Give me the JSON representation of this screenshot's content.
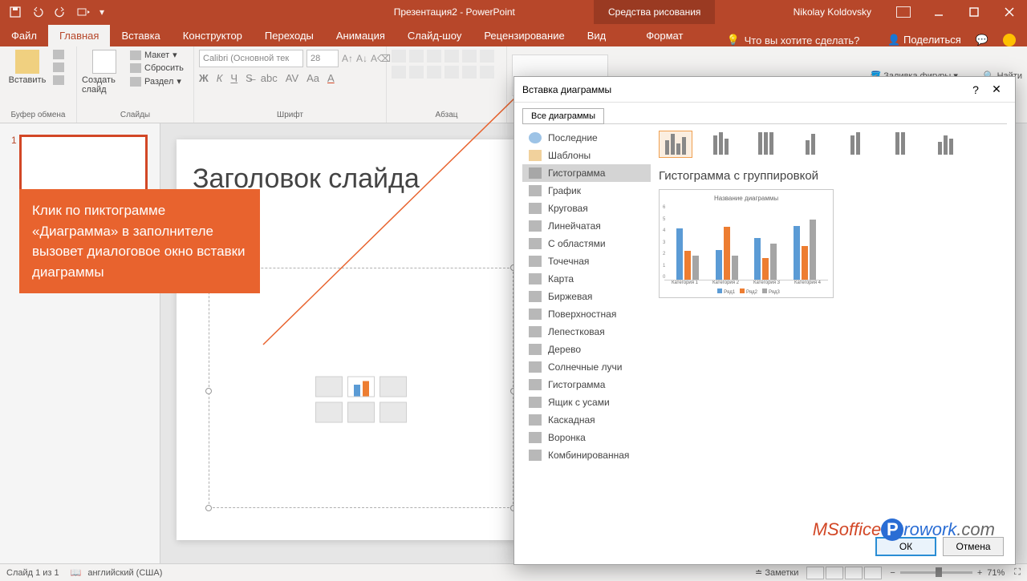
{
  "titlebar": {
    "doc_title": "Презентация2  -  PowerPoint",
    "tool_tab": "Средства рисования",
    "user": "Nikolay Koldovsky"
  },
  "tabs": {
    "file": "Файл",
    "home": "Главная",
    "insert": "Вставка",
    "design": "Конструктор",
    "transitions": "Переходы",
    "animations": "Анимация",
    "slideshow": "Слайд-шоу",
    "review": "Рецензирование",
    "view": "Вид",
    "format": "Формат",
    "tell_me": "Что вы хотите сделать?",
    "share": "Поделиться"
  },
  "ribbon": {
    "paste": "Вставить",
    "clipboard": "Буфер обмена",
    "new_slide": "Создать слайд",
    "layout": "Макет",
    "reset": "Сбросить",
    "section": "Раздел",
    "slides": "Слайды",
    "font_name": "Calibri (Основной тек",
    "font_size": "28",
    "font": "Шрифт",
    "paragraph": "Абзац",
    "shape_fill": "Заливка фигуры",
    "find": "Найти"
  },
  "thumb": {
    "num": "1"
  },
  "slide": {
    "title": "Заголовок слайда"
  },
  "callout": {
    "text": "Клик по пиктограмме «Диаграмма» в заполнителе вызовет диалоговое окно вставки диаграммы"
  },
  "dialog": {
    "title": "Вставка диаграммы",
    "tab_all": "Все диаграммы",
    "cats": {
      "recent": "Последние",
      "templates": "Шаблоны",
      "column": "Гистограмма",
      "line": "График",
      "pie": "Круговая",
      "bar": "Линейчатая",
      "area": "С областями",
      "scatter": "Точечная",
      "map": "Карта",
      "stock": "Биржевая",
      "surface": "Поверхностная",
      "radar": "Лепестковая",
      "treemap": "Дерево",
      "sunburst": "Солнечные лучи",
      "histogram": "Гистограмма",
      "boxwhisker": "Ящик с усами",
      "waterfall": "Каскадная",
      "funnel": "Воронка",
      "combo": "Комбинированная"
    },
    "subtype_title": "Гистограмма с группировкой",
    "preview_title": "Название диаграммы",
    "ok": "ОК",
    "cancel": "Отмена"
  },
  "chart_data": {
    "type": "bar",
    "title": "Название диаграммы",
    "categories": [
      "Категория 1",
      "Категория 2",
      "Категория 3",
      "Категория 4"
    ],
    "series": [
      {
        "name": "Ряд1",
        "values": [
          4.3,
          2.5,
          3.5,
          4.5
        ],
        "color": "#5b9bd5"
      },
      {
        "name": "Ряд2",
        "values": [
          2.4,
          4.4,
          1.8,
          2.8
        ],
        "color": "#ed7d31"
      },
      {
        "name": "Ряд3",
        "values": [
          2.0,
          2.0,
          3.0,
          5.0
        ],
        "color": "#a5a5a5"
      }
    ],
    "ylim": [
      0,
      6
    ],
    "yticks": [
      0,
      1,
      2,
      3,
      4,
      5,
      6
    ],
    "legend": [
      "Ряд1",
      "Ряд2",
      "Ряд3"
    ]
  },
  "status": {
    "slide_of": "Слайд 1 из 1",
    "lang": "английский (США)",
    "notes": "Заметки",
    "zoom": "71%"
  },
  "watermark": {
    "ms": "MSoffice",
    "ro": "rowork",
    "com": ".com"
  }
}
